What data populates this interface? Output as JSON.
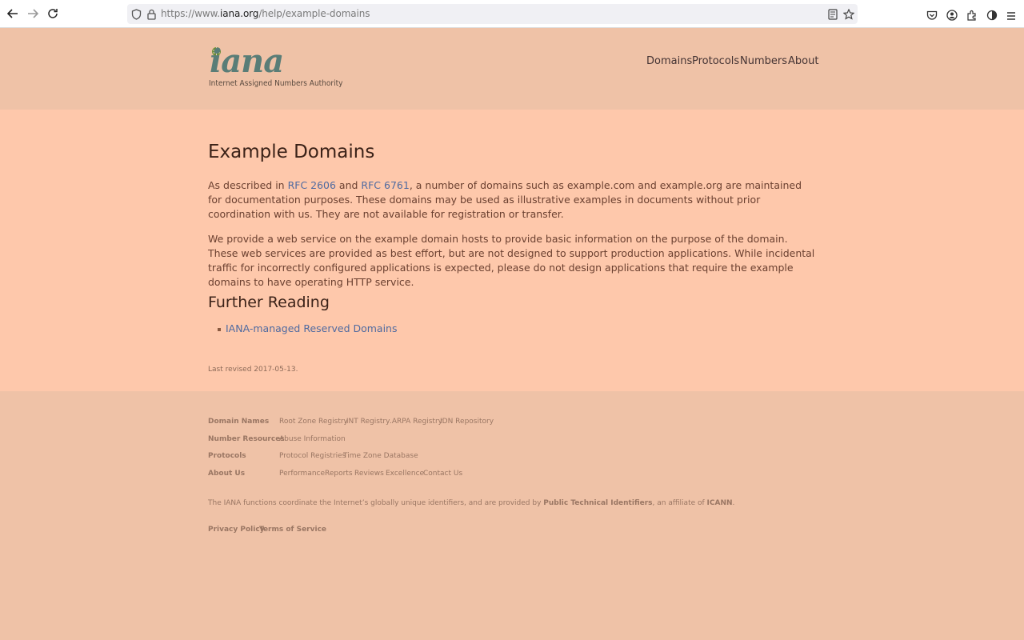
{
  "browser": {
    "url_prefix": "https://www.",
    "url_domain": "iana.org",
    "url_path": "/help/example-domains"
  },
  "header": {
    "logo_text": "iana",
    "logo_subtitle": "Internet Assigned Numbers Authority",
    "nav": [
      "Domains",
      "Protocols",
      "Numbers",
      "About"
    ]
  },
  "main": {
    "title": "Example Domains",
    "p1_a": "As described in ",
    "p1_link1": "RFC 2606",
    "p1_b": " and ",
    "p1_link2": "RFC 6761",
    "p1_c": ", a number of domains such as example.com and example.org are maintained for documentation purposes. These domains may be used as illustrative examples in documents without prior coordination with us. They are not available for registration or transfer.",
    "p2": "We provide a web service on the example domain hosts to provide basic information on the purpose of the domain. These web services are provided as best effort, but are not designed to support production applications. While incidental traffic for incorrectly configured applications is expected, please do not design applications that require the example domains to have operating HTTP service.",
    "further_heading": "Further Reading",
    "further_link": "IANA-managed Reserved Domains",
    "revised": "Last revised 2017-05-13."
  },
  "footer": {
    "domain_names": "Domain Names",
    "dn_links": [
      "Root Zone Registry",
      ".INT Registry",
      ".ARPA Registry",
      "IDN Repository"
    ],
    "number_resources": "Number Resources",
    "nr_links": [
      "Abuse Information"
    ],
    "protocols": "Protocols",
    "pr_links": [
      "Protocol Registries",
      "Time Zone Database"
    ],
    "about_us": "About Us",
    "au_links": [
      "Performance",
      "Reports",
      "Reviews",
      "Excellence",
      "Contact Us"
    ],
    "note_a": "The IANA functions coordinate the Internet’s globally unique identifiers, and are provided by ",
    "note_ptl": "Public Technical Identifiers",
    "note_b": ", an affiliate of ",
    "note_icann": "ICANN",
    "note_c": ".",
    "privacy": "Privacy Policy",
    "terms": "Terms of Service"
  }
}
